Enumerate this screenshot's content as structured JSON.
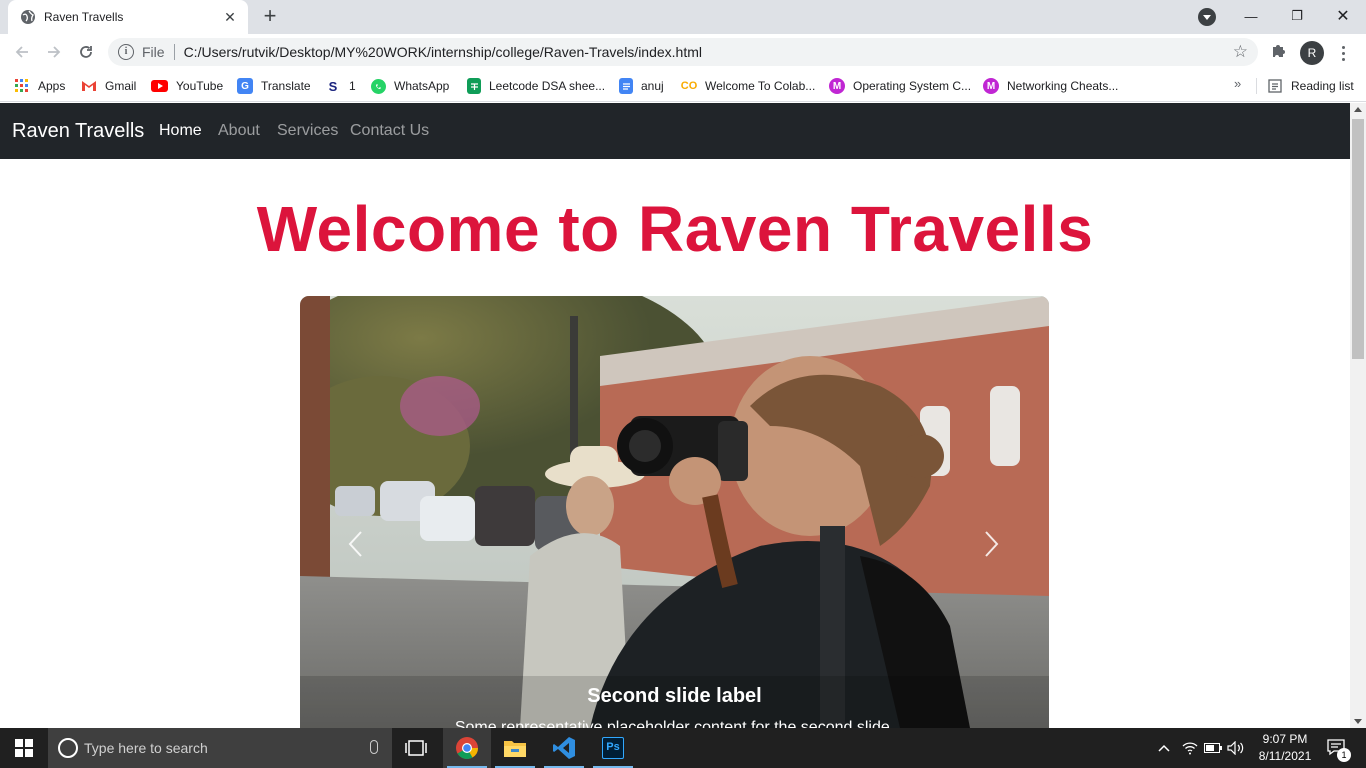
{
  "browser": {
    "tab_title": "Raven Travells",
    "tab_close": "✕",
    "new_tab": "+",
    "url_scheme": "File",
    "url": "C:/Users/rutvik/Desktop/MY%20WORK/internship/college/Raven-Travels/index.html",
    "profile_initial": "R",
    "window_controls": {
      "minimize": "—",
      "restore": "❐",
      "close": "✕"
    }
  },
  "bookmarks": {
    "items": [
      {
        "label": "Apps",
        "icon": "apps-grid-icon",
        "color": "#4285f4"
      },
      {
        "label": "Gmail",
        "icon": "gmail-icon",
        "color": "#ea4335"
      },
      {
        "label": "YouTube",
        "icon": "youtube-icon",
        "color": "#ff0000"
      },
      {
        "label": "Translate",
        "icon": "translate-icon",
        "color": "#4285f4"
      },
      {
        "label": "1",
        "icon": "s-icon",
        "color": "#1a237e"
      },
      {
        "label": "WhatsApp",
        "icon": "whatsapp-icon",
        "color": "#25d366"
      },
      {
        "label": "Leetcode DSA shee...",
        "icon": "sheets-icon",
        "color": "#0f9d58"
      },
      {
        "label": "anuj",
        "icon": "docs-icon",
        "color": "#4285f4"
      },
      {
        "label": "Welcome To Colab...",
        "icon": "colab-icon",
        "color": "#f9ab00"
      },
      {
        "label": "Operating System C...",
        "icon": "m-icon",
        "color": "#c026d3"
      },
      {
        "label": "Networking Cheats...",
        "icon": "m-icon",
        "color": "#c026d3"
      }
    ],
    "more": "»",
    "reading_list": "Reading list"
  },
  "site": {
    "brand": "Raven Travells",
    "nav": [
      "Home",
      "About",
      "Services",
      "Contact Us"
    ],
    "title": "Welcome to Raven Travells",
    "title_color": "#dc143c",
    "carousel": {
      "caption_label": "Second slide label",
      "caption_text": "Some representative placeholder content for the second slide."
    }
  },
  "taskbar": {
    "search_placeholder": "Type here to search",
    "apps": [
      "chrome-icon",
      "file-explorer-icon",
      "vscode-icon",
      "photoshop-icon"
    ],
    "photoshop_label": "Ps",
    "time": "9:07 PM",
    "date": "8/11/2021",
    "notification_count": "1"
  }
}
